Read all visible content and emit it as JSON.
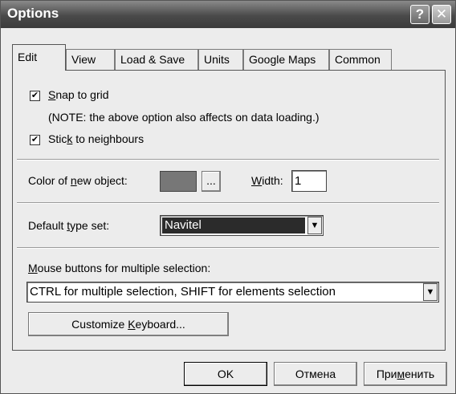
{
  "window": {
    "title": "Options",
    "help_glyph": "?",
    "close_glyph": "✕"
  },
  "tabs": [
    {
      "label": "Edit",
      "active": true
    },
    {
      "label": "View"
    },
    {
      "label": "Load & Save"
    },
    {
      "label": "Units"
    },
    {
      "label": "Google Maps"
    },
    {
      "label": "Common"
    }
  ],
  "edit": {
    "snap_to_grid": {
      "pre": "",
      "mnemonic": "S",
      "post": "nap to grid",
      "checked": true
    },
    "note": "(NOTE: the above option also affects on data loading.)",
    "stick_to_neighbours": {
      "pre": "Stic",
      "mnemonic": "k",
      "post": " to neighbours",
      "checked": true
    },
    "color_label": {
      "pre": "Color of ",
      "mnemonic": "n",
      "post": "ew object:"
    },
    "color_value": "#777777",
    "browse_label": "...",
    "width_label": {
      "pre": "",
      "mnemonic": "W",
      "post": "idth:"
    },
    "width_value": "1",
    "default_type_label": {
      "pre": "Default ",
      "mnemonic": "t",
      "post": "ype set:"
    },
    "default_type_value": "Navitel",
    "mouse_label": {
      "pre": "",
      "mnemonic": "M",
      "post": "ouse buttons for multiple selection:"
    },
    "mouse_value": "CTRL for multiple selection, SHIFT for elements selection",
    "customize": {
      "pre": "Customize ",
      "mnemonic": "K",
      "post": "eyboard..."
    },
    "check_glyph": "✔",
    "dropdown_glyph": "▼"
  },
  "footer": {
    "ok_label": "OK",
    "cancel_label": "Отмена",
    "apply": {
      "pre": "При",
      "mnemonic": "м",
      "post": "енить"
    }
  }
}
